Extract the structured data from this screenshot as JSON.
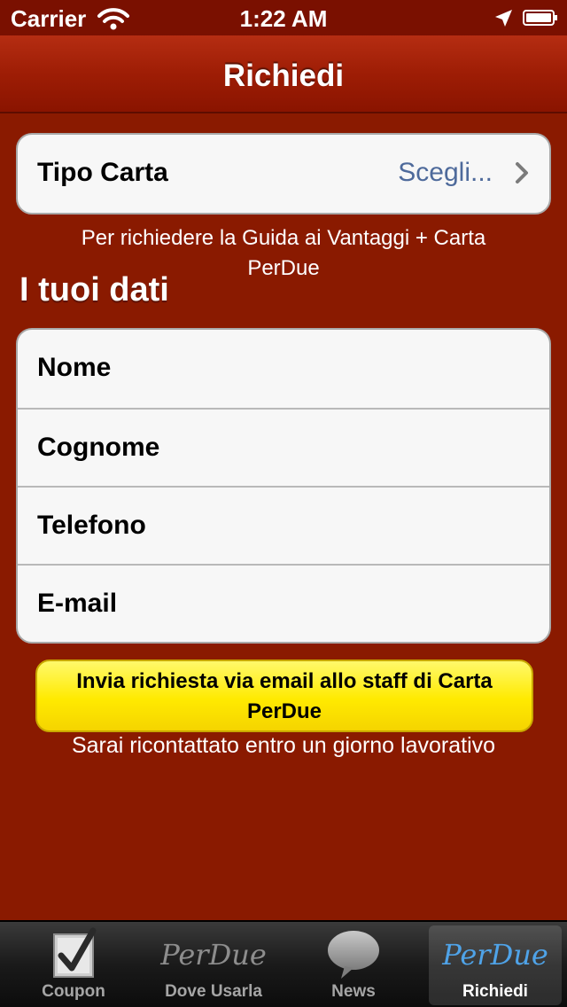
{
  "status_bar": {
    "carrier": "Carrier",
    "time": "1:22 AM",
    "wifi_icon": "wifi-icon",
    "location_icon": "location-arrow-icon",
    "battery_icon": "battery-icon"
  },
  "nav": {
    "title": "Richiedi"
  },
  "tipo_carta": {
    "label": "Tipo Carta",
    "value": "Scegli...",
    "value_color": "#4e6a9b"
  },
  "caption": {
    "line1": "Per richiedere la Guida ai Vantaggi + Carta",
    "line2": "PerDue"
  },
  "section": {
    "title": "I tuoi dati"
  },
  "fields": [
    {
      "label": "Nome"
    },
    {
      "label": "Cognome"
    },
    {
      "label": "Telefono"
    },
    {
      "label": "E-mail"
    }
  ],
  "send_button": {
    "line1": "Invia richiesta via email allo staff di Carta",
    "line2": "PerDue",
    "color": "#ffea00"
  },
  "footer_note": "Sarai ricontattato entro un giorno lavorativo",
  "tabs": [
    {
      "label": "Coupon",
      "icon": "checkbox-icon",
      "selected": false
    },
    {
      "label": "Dove Usarla",
      "icon": "perdue-logo-icon",
      "logo_text": "PerDue",
      "selected": false
    },
    {
      "label": "News",
      "icon": "speech-bubble-icon",
      "selected": false
    },
    {
      "label": "Richiedi",
      "icon": "perdue-logo-icon",
      "logo_text": "PerDue",
      "selected": true
    }
  ],
  "colors": {
    "background": "#8a1a00",
    "tab_selected_logo": "#4fa3e8"
  }
}
